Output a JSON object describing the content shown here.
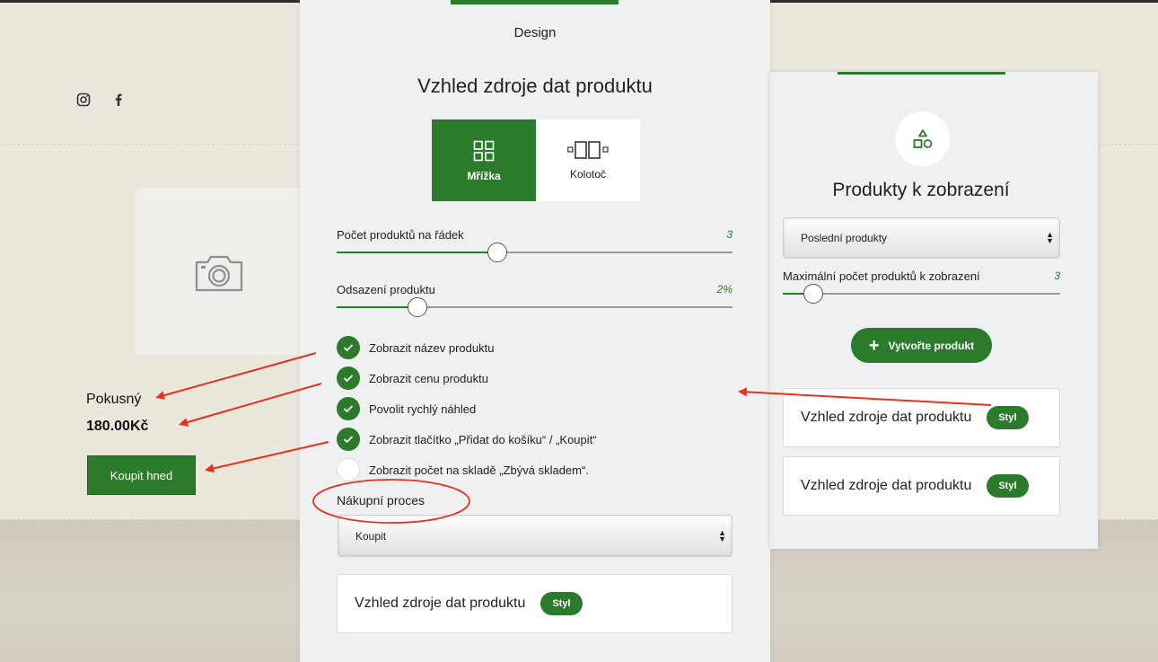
{
  "site": {
    "social_icons": [
      "instagram-icon",
      "facebook-icon"
    ],
    "product_name": "Pokusný",
    "product_price": "180.00Kč",
    "buy_label": "Koupit hned"
  },
  "design_panel": {
    "tab": "Design",
    "title": "Vzhled zdroje dat produktu",
    "layouts": [
      {
        "label": "Mřížka",
        "icon": "grid-icon",
        "selected": true
      },
      {
        "label": "Kolotoč",
        "icon": "carousel-icon",
        "selected": false
      }
    ],
    "sliders": [
      {
        "label": "Počet produktů na řádek",
        "value": "3",
        "level": 0.405
      },
      {
        "label": "Odsazení produktu",
        "value": "2%",
        "level": 0.205
      }
    ],
    "checkboxes": [
      {
        "label": "Zobrazit název produktu",
        "checked": true
      },
      {
        "label": "Zobrazit cenu produktu",
        "checked": true
      },
      {
        "label": "Povolit rychlý náhled",
        "checked": true
      },
      {
        "label": "Zobrazit tlačítko „Přidat do košíku“ / „Koupit“",
        "checked": true
      },
      {
        "label": "Zobrazit počet na skladě „Zbývá skladem“.",
        "checked": false
      }
    ],
    "purchase_process_label": "Nákupní proces",
    "purchase_process_value": "Koupit",
    "style_card_label": "Vzhled zdroje dat produktu",
    "style_button": "Styl"
  },
  "products_panel": {
    "icon": "shapes-icon",
    "title": "Produkty k zobrazení",
    "source_value": "Poslední produkty",
    "max_label": "Maximální počet produktů k zobrazení",
    "max_value": "3",
    "max_level": 0.11,
    "create_button": "Vytvořte produkt",
    "style_cards": [
      {
        "label": "Vzhled zdroje dat produktu",
        "button": "Styl"
      },
      {
        "label": "Vzhled zdroje dat produktu",
        "button": "Styl"
      }
    ]
  },
  "colors": {
    "accent": "#2c7a2c",
    "annotation": "#e8311a",
    "background": "#ebe7dc"
  }
}
